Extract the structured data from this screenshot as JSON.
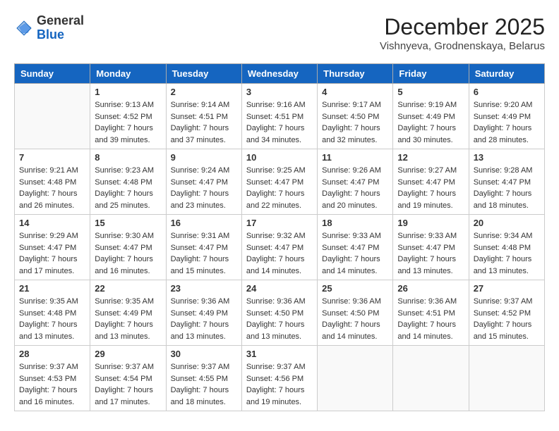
{
  "header": {
    "logo_general": "General",
    "logo_blue": "Blue",
    "month_title": "December 2025",
    "location": "Vishnyeva, Grodnenskaya, Belarus"
  },
  "weekdays": [
    "Sunday",
    "Monday",
    "Tuesday",
    "Wednesday",
    "Thursday",
    "Friday",
    "Saturday"
  ],
  "weeks": [
    [
      {
        "day": "",
        "empty": true
      },
      {
        "day": "1",
        "sunrise": "Sunrise: 9:13 AM",
        "sunset": "Sunset: 4:52 PM",
        "daylight": "Daylight: 7 hours and 39 minutes."
      },
      {
        "day": "2",
        "sunrise": "Sunrise: 9:14 AM",
        "sunset": "Sunset: 4:51 PM",
        "daylight": "Daylight: 7 hours and 37 minutes."
      },
      {
        "day": "3",
        "sunrise": "Sunrise: 9:16 AM",
        "sunset": "Sunset: 4:51 PM",
        "daylight": "Daylight: 7 hours and 34 minutes."
      },
      {
        "day": "4",
        "sunrise": "Sunrise: 9:17 AM",
        "sunset": "Sunset: 4:50 PM",
        "daylight": "Daylight: 7 hours and 32 minutes."
      },
      {
        "day": "5",
        "sunrise": "Sunrise: 9:19 AM",
        "sunset": "Sunset: 4:49 PM",
        "daylight": "Daylight: 7 hours and 30 minutes."
      },
      {
        "day": "6",
        "sunrise": "Sunrise: 9:20 AM",
        "sunset": "Sunset: 4:49 PM",
        "daylight": "Daylight: 7 hours and 28 minutes."
      }
    ],
    [
      {
        "day": "7",
        "sunrise": "Sunrise: 9:21 AM",
        "sunset": "Sunset: 4:48 PM",
        "daylight": "Daylight: 7 hours and 26 minutes."
      },
      {
        "day": "8",
        "sunrise": "Sunrise: 9:23 AM",
        "sunset": "Sunset: 4:48 PM",
        "daylight": "Daylight: 7 hours and 25 minutes."
      },
      {
        "day": "9",
        "sunrise": "Sunrise: 9:24 AM",
        "sunset": "Sunset: 4:47 PM",
        "daylight": "Daylight: 7 hours and 23 minutes."
      },
      {
        "day": "10",
        "sunrise": "Sunrise: 9:25 AM",
        "sunset": "Sunset: 4:47 PM",
        "daylight": "Daylight: 7 hours and 22 minutes."
      },
      {
        "day": "11",
        "sunrise": "Sunrise: 9:26 AM",
        "sunset": "Sunset: 4:47 PM",
        "daylight": "Daylight: 7 hours and 20 minutes."
      },
      {
        "day": "12",
        "sunrise": "Sunrise: 9:27 AM",
        "sunset": "Sunset: 4:47 PM",
        "daylight": "Daylight: 7 hours and 19 minutes."
      },
      {
        "day": "13",
        "sunrise": "Sunrise: 9:28 AM",
        "sunset": "Sunset: 4:47 PM",
        "daylight": "Daylight: 7 hours and 18 minutes."
      }
    ],
    [
      {
        "day": "14",
        "sunrise": "Sunrise: 9:29 AM",
        "sunset": "Sunset: 4:47 PM",
        "daylight": "Daylight: 7 hours and 17 minutes."
      },
      {
        "day": "15",
        "sunrise": "Sunrise: 9:30 AM",
        "sunset": "Sunset: 4:47 PM",
        "daylight": "Daylight: 7 hours and 16 minutes."
      },
      {
        "day": "16",
        "sunrise": "Sunrise: 9:31 AM",
        "sunset": "Sunset: 4:47 PM",
        "daylight": "Daylight: 7 hours and 15 minutes."
      },
      {
        "day": "17",
        "sunrise": "Sunrise: 9:32 AM",
        "sunset": "Sunset: 4:47 PM",
        "daylight": "Daylight: 7 hours and 14 minutes."
      },
      {
        "day": "18",
        "sunrise": "Sunrise: 9:33 AM",
        "sunset": "Sunset: 4:47 PM",
        "daylight": "Daylight: 7 hours and 14 minutes."
      },
      {
        "day": "19",
        "sunrise": "Sunrise: 9:33 AM",
        "sunset": "Sunset: 4:47 PM",
        "daylight": "Daylight: 7 hours and 13 minutes."
      },
      {
        "day": "20",
        "sunrise": "Sunrise: 9:34 AM",
        "sunset": "Sunset: 4:48 PM",
        "daylight": "Daylight: 7 hours and 13 minutes."
      }
    ],
    [
      {
        "day": "21",
        "sunrise": "Sunrise: 9:35 AM",
        "sunset": "Sunset: 4:48 PM",
        "daylight": "Daylight: 7 hours and 13 minutes."
      },
      {
        "day": "22",
        "sunrise": "Sunrise: 9:35 AM",
        "sunset": "Sunset: 4:49 PM",
        "daylight": "Daylight: 7 hours and 13 minutes."
      },
      {
        "day": "23",
        "sunrise": "Sunrise: 9:36 AM",
        "sunset": "Sunset: 4:49 PM",
        "daylight": "Daylight: 7 hours and 13 minutes."
      },
      {
        "day": "24",
        "sunrise": "Sunrise: 9:36 AM",
        "sunset": "Sunset: 4:50 PM",
        "daylight": "Daylight: 7 hours and 13 minutes."
      },
      {
        "day": "25",
        "sunrise": "Sunrise: 9:36 AM",
        "sunset": "Sunset: 4:50 PM",
        "daylight": "Daylight: 7 hours and 14 minutes."
      },
      {
        "day": "26",
        "sunrise": "Sunrise: 9:36 AM",
        "sunset": "Sunset: 4:51 PM",
        "daylight": "Daylight: 7 hours and 14 minutes."
      },
      {
        "day": "27",
        "sunrise": "Sunrise: 9:37 AM",
        "sunset": "Sunset: 4:52 PM",
        "daylight": "Daylight: 7 hours and 15 minutes."
      }
    ],
    [
      {
        "day": "28",
        "sunrise": "Sunrise: 9:37 AM",
        "sunset": "Sunset: 4:53 PM",
        "daylight": "Daylight: 7 hours and 16 minutes."
      },
      {
        "day": "29",
        "sunrise": "Sunrise: 9:37 AM",
        "sunset": "Sunset: 4:54 PM",
        "daylight": "Daylight: 7 hours and 17 minutes."
      },
      {
        "day": "30",
        "sunrise": "Sunrise: 9:37 AM",
        "sunset": "Sunset: 4:55 PM",
        "daylight": "Daylight: 7 hours and 18 minutes."
      },
      {
        "day": "31",
        "sunrise": "Sunrise: 9:37 AM",
        "sunset": "Sunset: 4:56 PM",
        "daylight": "Daylight: 7 hours and 19 minutes."
      },
      {
        "day": "",
        "empty": true
      },
      {
        "day": "",
        "empty": true
      },
      {
        "day": "",
        "empty": true
      }
    ]
  ]
}
